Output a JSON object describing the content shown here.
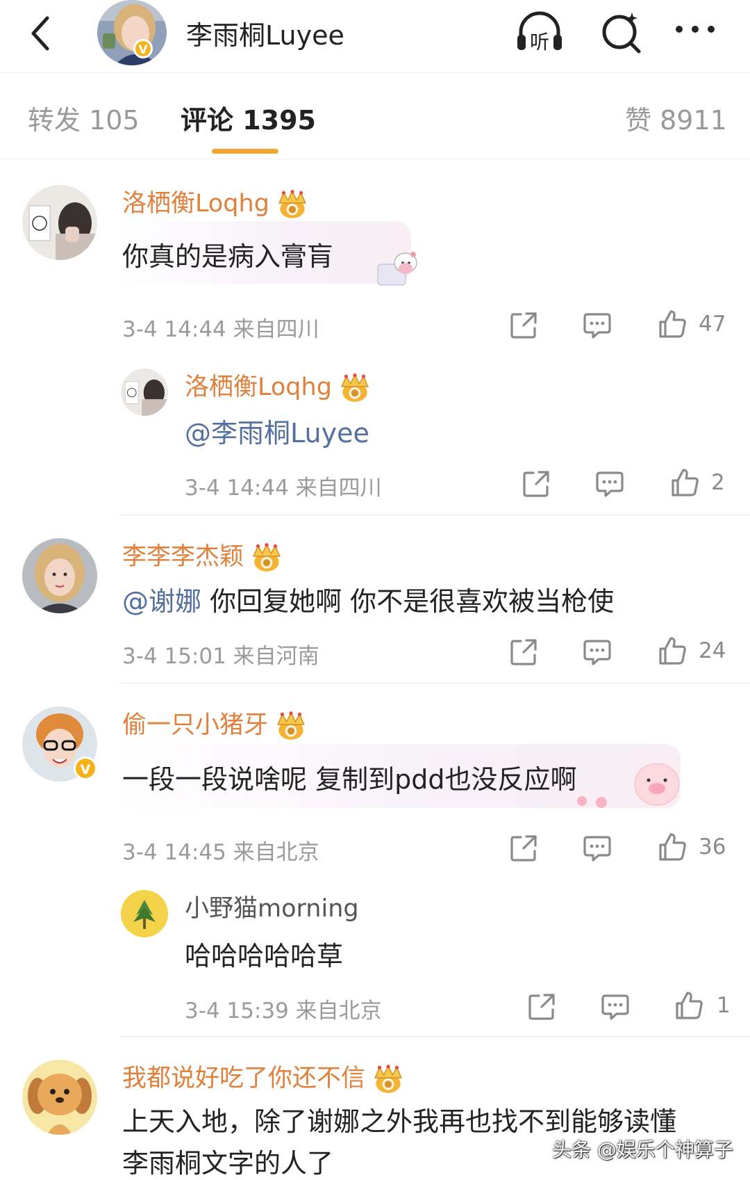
{
  "header": {
    "title": "李雨桐Luyee",
    "listen_label": "听",
    "verified_mark": "V"
  },
  "tabs": [
    {
      "label": "转发 105"
    },
    {
      "label": "评论 1395"
    },
    {
      "label": "赞 8911"
    }
  ],
  "comments": [
    {
      "name": "洛栖衡Loqhg",
      "text": "你真的是病入膏肓",
      "meta": "3-4 14:44 来自四川",
      "likes": "47",
      "reply": {
        "name": "洛栖衡Loqhg",
        "mention": "@李雨桐Luyee",
        "meta": "3-4 14:44 来自四川",
        "likes": "2"
      }
    },
    {
      "name": "李李李杰颖",
      "mention": "@谢娜",
      "text": " 你回复她啊 你不是很喜欢被当枪使",
      "meta": "3-4 15:01 来自河南",
      "likes": "24"
    },
    {
      "name": "偷一只小猪牙",
      "text": "一段一段说啥呢 复制到pdd也没反应啊",
      "meta": "3-4 14:45 来自北京",
      "likes": "36",
      "verified_mark": "V",
      "reply": {
        "name": "小野猫morning",
        "text": "哈哈哈哈哈草",
        "meta": "3-4 15:39 来自北京",
        "likes": "1"
      }
    },
    {
      "name": "我都说好吃了你还不信",
      "line1": "上天入地，除了谢娜之外我再也找不到能够读懂",
      "line2": "李雨桐文字的人了"
    }
  ],
  "watermark": "头条 @娱乐个神算子",
  "icons": [
    "back-arrow-icon",
    "headphones-icon",
    "search-icon",
    "more-icon",
    "share-icon",
    "comment-icon",
    "like-icon",
    "crown-icon"
  ],
  "colors": {
    "accent": "#f1a531",
    "username": "#e0803b",
    "mention": "#536f9e",
    "meta": "#9a9a9a"
  }
}
